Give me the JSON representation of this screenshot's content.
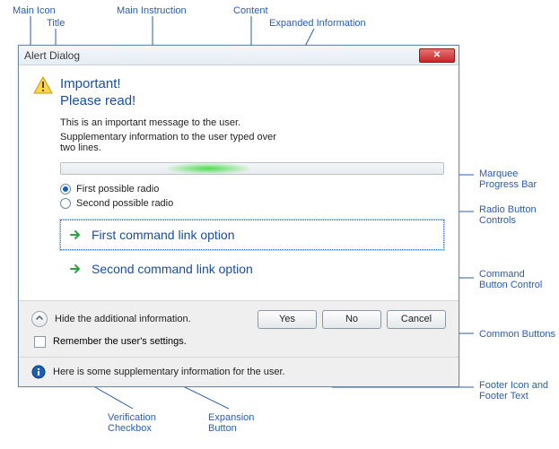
{
  "annotations": {
    "main_icon": "Main Icon",
    "title": "Title",
    "main_instruction": "Main Instruction",
    "content": "Content",
    "expanded_info": "Expanded Information",
    "marquee": "Marquee\nProgress Bar",
    "radio_controls": "Radio Button\nControls",
    "command_button": "Command\nButton Control",
    "common_buttons": "Common Buttons",
    "footer": "Footer Icon and\nFooter Text",
    "verification": "Verification\nCheckbox",
    "expansion": "Expansion\nButton"
  },
  "dialog": {
    "title": "Alert Dialog",
    "main_instruction_line1": "Important!",
    "main_instruction_line2": "Please read!",
    "content_text": "This is an important message to the user.",
    "expanded_text": "Supplementary information to the user typed over two lines.",
    "radios": [
      {
        "label": "First possible radio",
        "checked": true
      },
      {
        "label": "Second possible radio",
        "checked": false
      }
    ],
    "command_links": [
      {
        "label": "First command link option",
        "focused": true
      },
      {
        "label": "Second command link option",
        "focused": false
      }
    ],
    "expand_label": "Hide the additional information.",
    "buttons": {
      "yes": "Yes",
      "no": "No",
      "cancel": "Cancel"
    },
    "verification_label": "Remember the user's settings.",
    "footer_text": "Here is some supplementary information for the user."
  }
}
